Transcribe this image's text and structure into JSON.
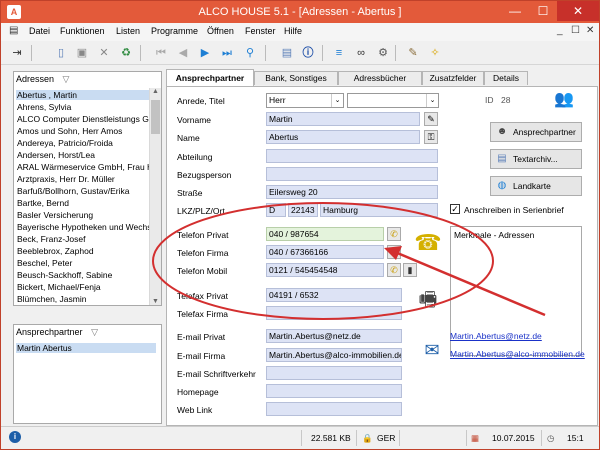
{
  "window": {
    "title": "ALCO HOUSE 5.1 - [Adressen - Abertus ]",
    "minimize": "—",
    "maximize": "☐",
    "close": "✕"
  },
  "menu": {
    "items": [
      "Datei",
      "Funktionen",
      "Listen",
      "Programme",
      "Öffnen",
      "Fenster",
      "Hilfe"
    ],
    "mdi_controls": [
      "_",
      "☐",
      "✕"
    ]
  },
  "adressen": {
    "header": "Adressen",
    "filter_icon": "▽",
    "items": [
      "Abertus , Martin",
      "Ahrens, Sylvia",
      "ALCO Computer Dienstleistungs Gml",
      "Amos und Sohn, Herr Amos",
      "Andereya, Patricio/Froida",
      "Andersen, Horst/Lea",
      "ARAL Wärmeservice GmbH, Frau H",
      "Arztpraxis, Herr Dr. Müller",
      "Barfuß/Bollhorn, Gustav/Erika",
      "Bartke, Bernd",
      "Basler Versicherung",
      "Bayerische Hypotheken und Wechs",
      "Beck, Franz-Josef",
      "Beeblebrox, Zaphod",
      "Beschel, Peter",
      "Beusch-Sackhoff, Sabine",
      "Bickert, Michael/Fenja",
      "Blümchen, Jasmin"
    ]
  },
  "ansprechpartner_list": {
    "header": "Ansprechpartner",
    "filter_icon": "▽",
    "items": [
      "Martin Abertus"
    ]
  },
  "tabs": [
    "Ansprechpartner",
    "Bank, Sonstiges",
    "Adressbücher",
    "Zusatzfelder",
    "Details"
  ],
  "form": {
    "anrede_label": "Anrede, Titel",
    "anrede_value": "Herr",
    "titel_value": "",
    "id_label": "ID",
    "id_value": "28",
    "vorname_label": "Vorname",
    "vorname_value": "Martin",
    "name_label": "Name",
    "name_value": "Abertus",
    "abteilung_label": "Abteilung",
    "abteilung_value": "",
    "bezugsperson_label": "Bezugsperson",
    "bezugsperson_value": "",
    "strasse_label": "Straße",
    "strasse_value": "Eilersweg 20",
    "lkz_label": "LKZ/PLZ/Ort",
    "lkz_value": "D",
    "plz_value": "22143",
    "ort_value": "Hamburg",
    "serienbrief_label": "Anschreiben in Serienbrief",
    "tel_privat_label": "Telefon Privat",
    "tel_privat_value": "040 / 987654",
    "tel_firma_label": "Telefon Firma",
    "tel_firma_value": "040 / 67366166",
    "tel_mobil_label": "Telefon Mobil",
    "tel_mobil_value": "0121 / 545454548",
    "fax_privat_label": "Telefax Privat",
    "fax_privat_value": "04191 / 6532",
    "fax_firma_label": "Telefax Firma",
    "fax_firma_value": "",
    "email_privat_label": "E-mail Privat",
    "email_privat_value": "Martin.Abertus@netz.de",
    "email_firma_label": "E-mail Firma",
    "email_firma_value": "Martin.Abertus@alco-immobilien.de",
    "email_schrift_label": "E-mail Schriftverkehr",
    "email_schrift_value": "",
    "homepage_label": "Homepage",
    "homepage_value": "",
    "weblink_label": "Web Link",
    "weblink_value": "",
    "link_privat": "Martin.Abertus@netz.de",
    "link_firma": "Martin.Abertus@alco-immobilien.de"
  },
  "buttons": {
    "ansprechpartner": "Ansprechpartner",
    "textarchiv": "Textarchiv...",
    "landkarte": "Landkarte"
  },
  "merkmale": {
    "header": "Merkmale - Adressen"
  },
  "status": {
    "info_icon": "i",
    "memory": "22.581 KB",
    "language": "GER",
    "date": "10.07.2015",
    "time": "15:1"
  },
  "colors": {
    "titlebar": "#e35a3a",
    "field_bg": "#dde3f5",
    "field_green": "#e4f3dc",
    "annotation_red": "#d32f2f",
    "link": "#1a32c8"
  }
}
